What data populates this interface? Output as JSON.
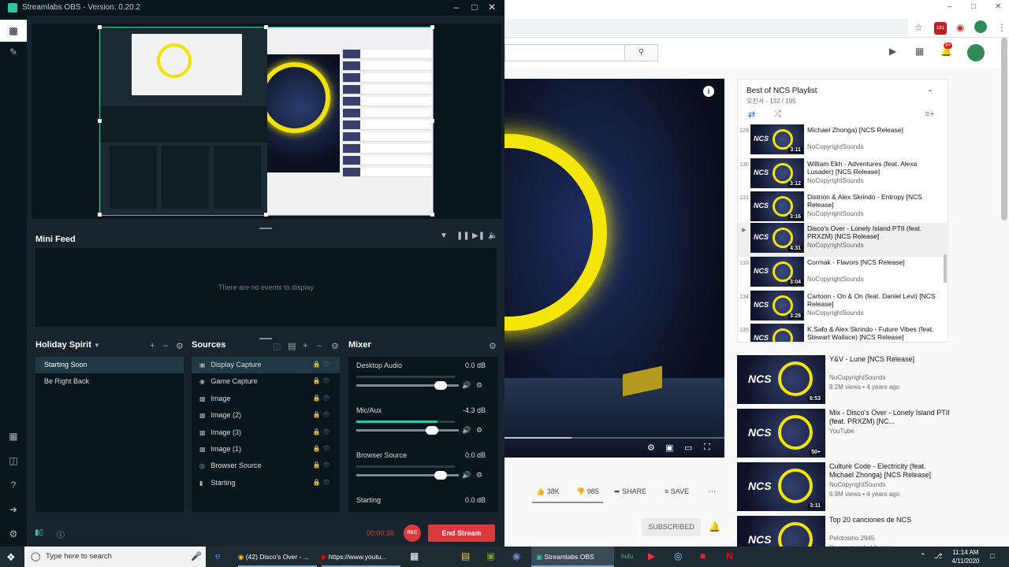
{
  "obs": {
    "title": "Streamlabs OBS - Version: 0.20.2",
    "minifeed": {
      "title": "Mini Feed",
      "empty_text": "There are no events to display"
    },
    "scenes": {
      "title": "Holiday Spirit",
      "items": [
        {
          "label": "Starting Soon",
          "selected": true
        },
        {
          "label": "Be Right Back",
          "selected": false
        }
      ]
    },
    "sources": {
      "title": "Sources",
      "items": [
        {
          "label": "Display Capture",
          "icon": "monitor-icon"
        },
        {
          "label": "Game Capture",
          "icon": "gamepad-icon"
        },
        {
          "label": "Image",
          "icon": "image-icon"
        },
        {
          "label": "Image (2)",
          "icon": "image-icon"
        },
        {
          "label": "Image (3)",
          "icon": "image-icon"
        },
        {
          "label": "Image (1)",
          "icon": "image-icon"
        },
        {
          "label": "Browser Source",
          "icon": "globe-icon"
        },
        {
          "label": "Starting",
          "icon": "file-icon"
        }
      ]
    },
    "mixer": {
      "title": "Mixer",
      "items": [
        {
          "label": "Desktop Audio",
          "db": "0.0 dB",
          "level": 0,
          "volume": 0.82
        },
        {
          "label": "Mic/Aux",
          "db": "-4.3 dB",
          "level": 0.82,
          "volume": 0.74
        },
        {
          "label": "Browser Source",
          "db": "0.0 dB",
          "level": 0,
          "volume": 0.82
        },
        {
          "label": "Starting",
          "db": "0.0 dB",
          "level": 0,
          "volume": 0.82
        }
      ]
    },
    "timer": "00:00:38",
    "rec_label": "REC",
    "end_stream_label": "End Stream"
  },
  "youtube": {
    "playlist": {
      "title": "Best of NCS Playlist",
      "subtitle": "오진서 - 132 / 195",
      "items": [
        {
          "num": "129",
          "title": "Michael Zhonga) [NCS Release]",
          "channel": "NoCopyrightSounds",
          "duration": "3:11"
        },
        {
          "num": "130",
          "title": "William Ekh - Adventures (feat. Alexa Lusader) [NCS Release]",
          "channel": "NoCopyrightSounds",
          "duration": "3:12"
        },
        {
          "num": "131",
          "title": "Distrion & Alex Skrindo - Entropy [NCS Release]",
          "channel": "NoCopyrightSounds",
          "duration": "3:16"
        },
        {
          "num": "▶",
          "title": "Disco's Over - Lonely Island PTII (feat. PRXZM) [NCS Release]",
          "channel": "NoCopyrightSounds",
          "duration": "4:31"
        },
        {
          "num": "133",
          "title": "Cormak - Flavors [NCS Release]",
          "channel": "NoCopyrightSounds",
          "duration": "3:04"
        },
        {
          "num": "134",
          "title": "Cartoon - On & On (feat. Daniel Levi) [NCS Release]",
          "channel": "NoCopyrightSounds",
          "duration": "3:28"
        },
        {
          "num": "135",
          "title": "K.Safo & Alex Skrindo - Future Vibes (feat. Stewart Wallace) [NCS Release]",
          "channel": "NoCopyrightSounds",
          "duration": "3:18"
        }
      ]
    },
    "recommended": [
      {
        "title": "Y&V - Lune [NCS Release]",
        "channel": "NoCopyrightSounds",
        "views": "8.2M views • 4 years ago",
        "duration": "6:53"
      },
      {
        "title": "Mix - Disco's Over - Lonely Island PTII (feat. PRXZM) [NC...",
        "channel": "YouTube",
        "views": "",
        "duration": "50+"
      },
      {
        "title": "Culture Code - Electricity (feat. Michael Zhonga) [NCS Release]",
        "channel": "NoCopyrightSounds",
        "views": "6.9M views • 4 years ago",
        "duration": "3:11"
      },
      {
        "title": "Top 20 canciones de NCS",
        "channel": "Pelotosino 2945",
        "views": "Recommended for you",
        "duration": ""
      }
    ],
    "actions": {
      "likes": "38K",
      "dislikes": "985",
      "share": "SHARE",
      "save": "SAVE"
    },
    "subscribed": "SUBSCRIBED",
    "notification_count": "9+",
    "tab_badge": "181"
  },
  "taskbar": {
    "search_placeholder": "Type here to search",
    "apps": [
      {
        "label": "(42) Disco's Over - ..."
      },
      {
        "label": "https://www.youtu..."
      },
      {
        "label": "Streamlabs OBS"
      }
    ],
    "time": "11:14 AM",
    "date": "4/11/2020"
  }
}
